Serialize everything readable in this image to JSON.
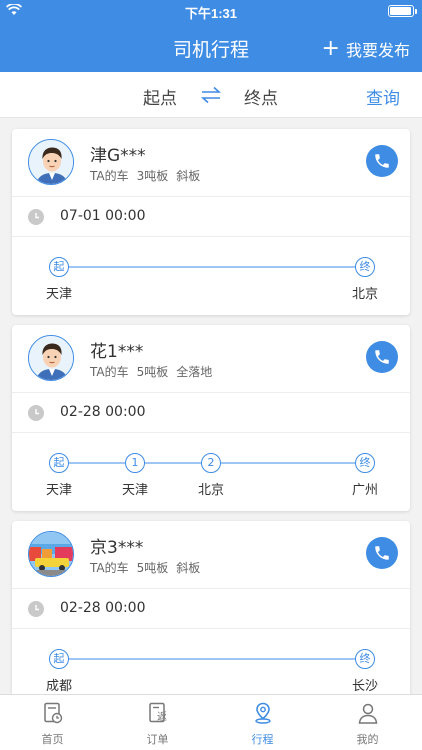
{
  "status_bar": {
    "time": "下午1:31",
    "battery_level": 1.0
  },
  "header": {
    "title": "司机行程",
    "publish_label": "我要发布",
    "publish_icon": "plus"
  },
  "search": {
    "start_label": "起点",
    "end_label": "终点",
    "query_label": "查询",
    "swap_icon": "swap-arrows"
  },
  "trips": [
    {
      "driver": "津G***",
      "truck": {
        "owner": "TA的车",
        "tonnage": "3吨板",
        "type": "斜板"
      },
      "time": "07-01 00:00",
      "stops": [
        {
          "marker": "起",
          "city": "天津"
        },
        {
          "marker": "终",
          "city": "北京"
        }
      ]
    },
    {
      "driver": "花1***",
      "truck": {
        "owner": "TA的车",
        "tonnage": "5吨板",
        "type": "全落地"
      },
      "time": "02-28 00:00",
      "stops": [
        {
          "marker": "起",
          "city": "天津"
        },
        {
          "marker": "1",
          "city": "天津"
        },
        {
          "marker": "2",
          "city": "北京"
        },
        {
          "marker": "终",
          "city": "广州"
        }
      ]
    },
    {
      "driver": "京3***",
      "truck": {
        "owner": "TA的车",
        "tonnage": "5吨板",
        "type": "斜板"
      },
      "time": "02-28 00:00",
      "stops": [
        {
          "marker": "起",
          "city": "成都"
        },
        {
          "marker": "终",
          "city": "长沙"
        }
      ]
    }
  ],
  "tabs": [
    {
      "label": "首页",
      "icon": "home-doc-icon",
      "active": false
    },
    {
      "label": "订单",
      "icon": "order-icon",
      "active": false
    },
    {
      "label": "行程",
      "icon": "location-pin-icon",
      "active": true
    },
    {
      "label": "我的",
      "icon": "user-icon",
      "active": false
    }
  ],
  "colors": {
    "primary": "#3e8ce4"
  }
}
